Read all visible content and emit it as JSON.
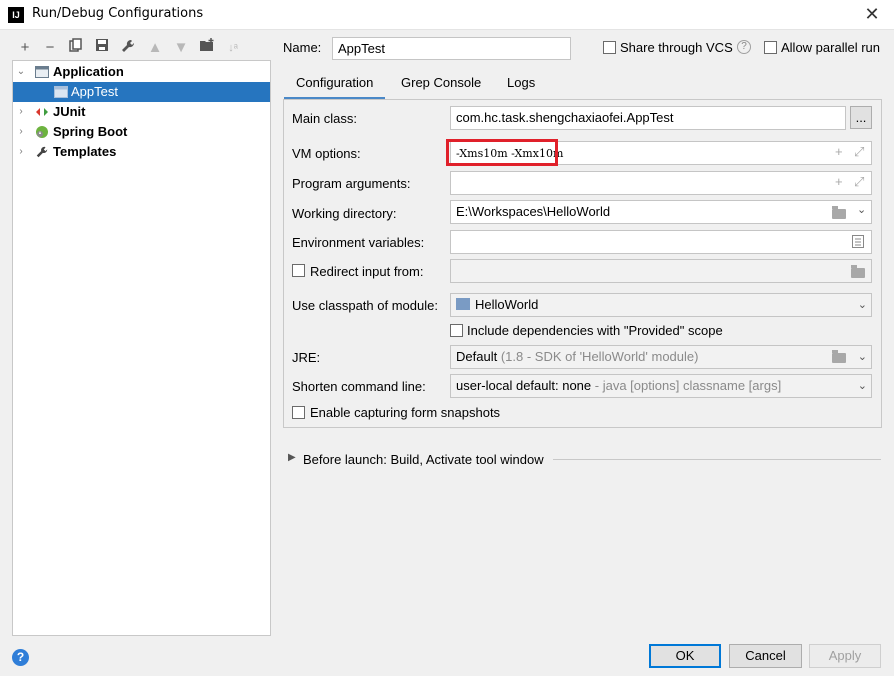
{
  "window": {
    "title": "Run/Debug Configurations",
    "icon_text": "IJ"
  },
  "toolbar": {
    "buttons": [
      "add-icon",
      "remove-icon",
      "copy-icon",
      "save-icon",
      "wrench-icon",
      "move-up-icon",
      "move-down-icon",
      "folder-add-icon",
      "sort-icon"
    ]
  },
  "tree": {
    "items": [
      {
        "label": "Application",
        "bold": true,
        "expanded": true
      },
      {
        "label": "AppTest",
        "selected": true
      },
      {
        "label": "JUnit",
        "bold": true
      },
      {
        "label": "Spring Boot",
        "bold": true
      },
      {
        "label": "Templates",
        "bold": true
      }
    ]
  },
  "header": {
    "name_label": "Name:",
    "name_value": "AppTest",
    "share_vcs": "Share through VCS",
    "allow_parallel": "Allow parallel run"
  },
  "tabs": [
    "Configuration",
    "Grep Console",
    "Logs"
  ],
  "form": {
    "main_class_label": "Main class:",
    "main_class_value": "com.hc.task.shengchaxiaofei.AppTest",
    "browse_label": "...",
    "vm_options_label": "VM options:",
    "vm_options_value": "-Xms10m -Xmx10m",
    "program_args_label": "Program arguments:",
    "program_args_value": "",
    "working_dir_label": "Working directory:",
    "working_dir_value": "E:\\Workspaces\\HelloWorld",
    "env_vars_label": "Environment variables:",
    "env_vars_value": "",
    "redirect_label": "Redirect input from:",
    "classpath_label": "Use classpath of module:",
    "classpath_value": "HelloWorld",
    "include_deps_label": "Include dependencies with \"Provided\" scope",
    "jre_label": "JRE:",
    "jre_value": "Default",
    "jre_hint": "(1.8 - SDK of 'HelloWorld' module)",
    "shorten_label": "Shorten command line:",
    "shorten_value": "user-local default: none",
    "shorten_hint": "- java [options] classname [args]",
    "snapshots_label": "Enable capturing form snapshots"
  },
  "before_launch": "Before launch: Build, Activate tool window",
  "buttons": {
    "ok": "OK",
    "cancel": "Cancel",
    "apply": "Apply",
    "help": "?"
  },
  "colors": {
    "selection": "#2675bf",
    "highlight_box": "#e0202a",
    "tab_underline": "#4a88c7"
  }
}
